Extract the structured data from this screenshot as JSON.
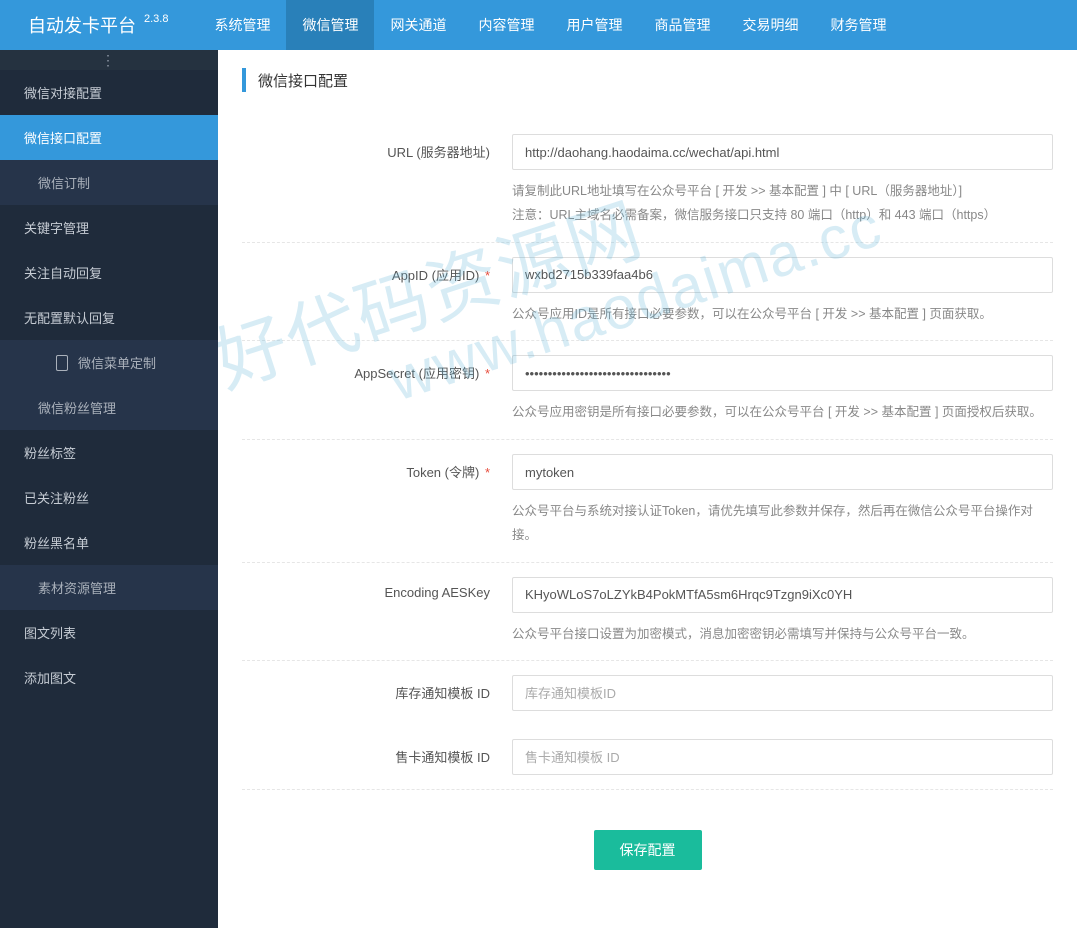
{
  "brand": "自动发卡平台",
  "version": "2.3.8",
  "topnav": [
    {
      "label": "系统管理"
    },
    {
      "label": "微信管理",
      "active": true
    },
    {
      "label": "网关通道"
    },
    {
      "label": "内容管理"
    },
    {
      "label": "用户管理"
    },
    {
      "label": "商品管理"
    },
    {
      "label": "交易明细"
    },
    {
      "label": "财务管理"
    }
  ],
  "sidebar": {
    "items": [
      {
        "label": "微信对接配置",
        "type": "item"
      },
      {
        "label": "微信接口配置",
        "type": "item",
        "active": true
      },
      {
        "label": "微信订制",
        "type": "sub"
      },
      {
        "label": "关键字管理",
        "type": "item"
      },
      {
        "label": "关注自动回复",
        "type": "item"
      },
      {
        "label": "无配置默认回复",
        "type": "item"
      },
      {
        "label": "微信菜单定制",
        "type": "sub2",
        "icon": "mobile"
      },
      {
        "label": "微信粉丝管理",
        "type": "sub"
      },
      {
        "label": "粉丝标签",
        "type": "item"
      },
      {
        "label": "已关注粉丝",
        "type": "item"
      },
      {
        "label": "粉丝黑名单",
        "type": "item"
      },
      {
        "label": "素材资源管理",
        "type": "sub"
      },
      {
        "label": "图文列表",
        "type": "item"
      },
      {
        "label": "添加图文",
        "type": "item"
      }
    ]
  },
  "panel_title": "微信接口配置",
  "form": {
    "url": {
      "label": "URL (服务器地址)",
      "value": "http://daohang.haodaima.cc/wechat/api.html",
      "help1": "请复制此URL地址填写在公众号平台 [ 开发 >> 基本配置 ] 中 [ URL（服务器地址）]",
      "help2": "注意：URL主域名必需备案，微信服务接口只支持 80 端口（http）和 443 端口（https）"
    },
    "appid": {
      "label": "AppID (应用ID)",
      "value": "wxbd2715b339faa4b6",
      "help": "公众号应用ID是所有接口必要参数，可以在公众号平台 [ 开发 >> 基本配置 ] 页面获取。"
    },
    "appsecret": {
      "label": "AppSecret (应用密钥)",
      "value": "••••••••••••••••••••••••••••••••",
      "help": "公众号应用密钥是所有接口必要参数，可以在公众号平台 [ 开发 >> 基本配置 ] 页面授权后获取。"
    },
    "token": {
      "label": "Token (令牌)",
      "value": "mytoken",
      "help": "公众号平台与系统对接认证Token，请优先填写此参数并保存，然后再在微信公众号平台操作对接。"
    },
    "aeskey": {
      "label": "Encoding AESKey",
      "value": "KHyoWLoS7oLZYkB4PokMTfA5sm6Hrqc9Tzgn9iXc0YH",
      "help": "公众号平台接口设置为加密模式，消息加密密钥必需填写并保持与公众号平台一致。"
    },
    "stock_tpl": {
      "label": "库存通知模板 ID",
      "placeholder": "库存通知模板ID"
    },
    "sell_tpl": {
      "label": "售卡通知模板 ID",
      "placeholder": "售卡通知模板 ID"
    }
  },
  "save_label": "保存配置",
  "watermark": {
    "line1": "好代码资源网",
    "line2": "www.haodaima.cc"
  }
}
